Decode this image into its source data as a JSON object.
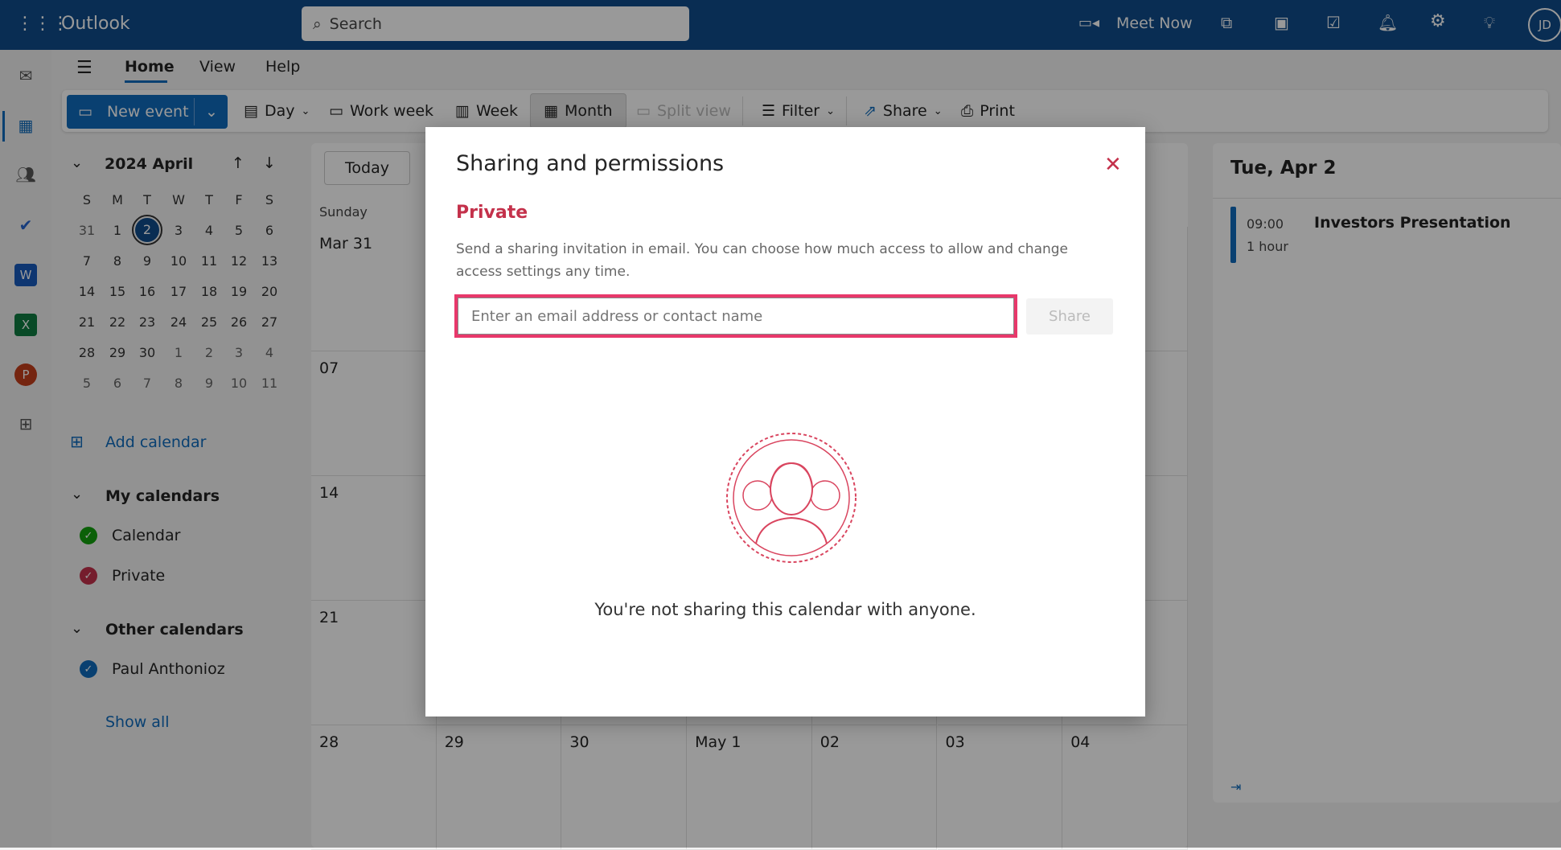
{
  "topbar": {
    "app_name": "Outlook",
    "search_placeholder": "Search",
    "meet_now": "Meet Now",
    "avatar_initials": "JD",
    "brand_color": "#0f4c8a"
  },
  "nav_tabs": [
    {
      "label": "Home",
      "active": true
    },
    {
      "label": "View"
    },
    {
      "label": "Help"
    }
  ],
  "toolbar": {
    "new_event": "New event",
    "day": "Day",
    "work_week": "Work week",
    "week": "Week",
    "month": "Month",
    "split_view": "Split view",
    "filter": "Filter",
    "share": "Share",
    "print": "Print"
  },
  "mini_calendar": {
    "title": "2024 April",
    "weekdays": [
      "S",
      "M",
      "T",
      "W",
      "T",
      "F",
      "S"
    ],
    "selected": "2",
    "weeks": [
      [
        "31",
        "1",
        "2",
        "3",
        "4",
        "5",
        "6"
      ],
      [
        "7",
        "8",
        "9",
        "10",
        "11",
        "12",
        "13"
      ],
      [
        "14",
        "15",
        "16",
        "17",
        "18",
        "19",
        "20"
      ],
      [
        "21",
        "22",
        "23",
        "24",
        "25",
        "26",
        "27"
      ],
      [
        "28",
        "29",
        "30",
        "1",
        "2",
        "3",
        "4"
      ],
      [
        "5",
        "6",
        "7",
        "8",
        "9",
        "10",
        "11"
      ]
    ]
  },
  "sidebar": {
    "add_calendar": "Add calendar",
    "my_calendars": "My calendars",
    "calendars": [
      {
        "label": "Calendar",
        "color": "#13a10e"
      },
      {
        "label": "Private",
        "color": "#c4314b"
      }
    ],
    "other_calendars": "Other calendars",
    "others": [
      {
        "label": "Paul Anthonioz",
        "color": "#0f6cbd"
      }
    ],
    "show_all": "Show all"
  },
  "month_grid": {
    "today_button": "Today",
    "first_day_header": "Sunday",
    "first_column": [
      "Mar 31",
      "07",
      "14",
      "21"
    ],
    "last_row": [
      "28",
      "29",
      "30",
      "May 1",
      "02",
      "03",
      "04"
    ]
  },
  "agenda": {
    "date": "Tue, Apr 2",
    "events": [
      {
        "time": "09:00",
        "duration": "1 hour",
        "title": "Investors Presentation"
      }
    ]
  },
  "modal": {
    "title": "Sharing and permissions",
    "calendar_name": "Private",
    "description": "Send a sharing invitation in email. You can choose how much access to allow and change access settings any time.",
    "input_placeholder": "Enter an email address or contact name",
    "share_button": "Share",
    "empty_message": "You're not sharing this calendar with anyone.",
    "accent_color": "#c4314b",
    "highlight_color": "#e8386b"
  }
}
